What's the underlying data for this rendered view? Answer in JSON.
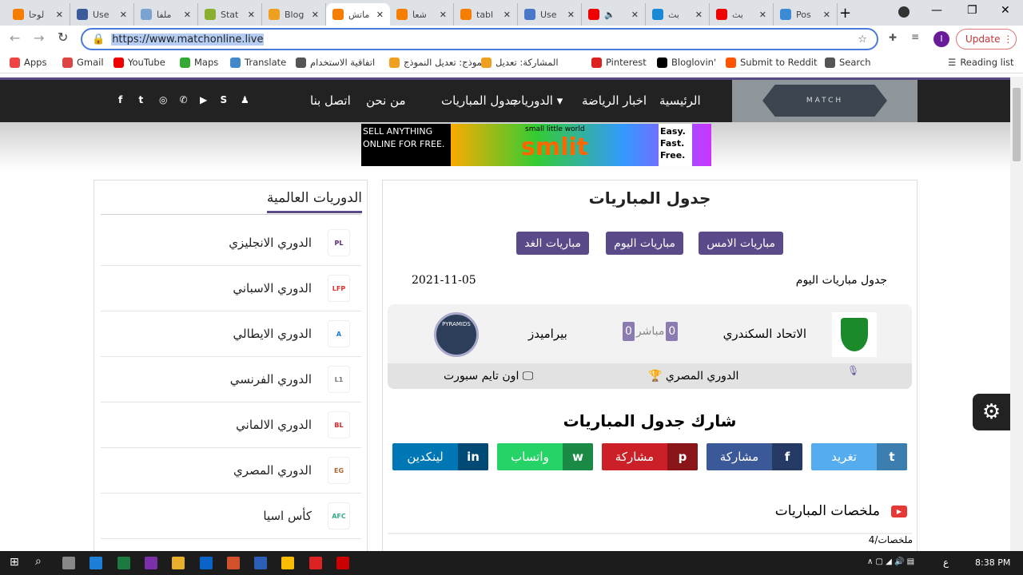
{
  "browser": {
    "tabs": [
      {
        "title": "لوحا",
        "color": "#f57d00"
      },
      {
        "title": "Use",
        "color": "#3a5a9a"
      },
      {
        "title": "ملفا",
        "color": "#7aa3d0"
      },
      {
        "title": "Stat",
        "color": "#8bb030"
      },
      {
        "title": "Blog",
        "color": "#f0a020"
      },
      {
        "title": "ماتش",
        "color": "#f57d00",
        "active": true
      },
      {
        "title": "شعا",
        "color": "#f57d00"
      },
      {
        "title": "tabl",
        "color": "#f57d00"
      },
      {
        "title": "Use",
        "color": "#4a78c8"
      },
      {
        "title": "🔈",
        "color": "#e00"
      },
      {
        "title": "بث",
        "color": "#1a8ad6"
      },
      {
        "title": "بث",
        "color": "#e00"
      },
      {
        "title": "Pos",
        "color": "#3a8ad6"
      }
    ],
    "new_tab": "+",
    "url": "https://www.matchonline.live",
    "profile_initial": "I",
    "update_label": "Update",
    "bookmarks": [
      "Apps",
      "Gmail",
      "YouTube",
      "Maps",
      "Translate",
      "اتفاقية الاستخدام",
      "النموذج: تعديل النموذج",
      "المشاركة: تعديل",
      "Pinterest",
      "Bloglovin'",
      "Submit to Reddit",
      "Search"
    ],
    "reading_list": "Reading list"
  },
  "site": {
    "logo_text": "MATCH",
    "nav": [
      "الرئيسية",
      "اخبار الرياضة",
      "الدوريات ▾",
      "جدول المباريات",
      "من نحن",
      "اتصل بنا"
    ],
    "social_icons": [
      "facebook-icon",
      "twitter-icon",
      "instagram-icon",
      "whatsapp-icon",
      "youtube-icon",
      "skype-icon",
      "snapchat-icon"
    ],
    "ad": {
      "left": "SELL ANYTHING ONLINE FOR FREE.",
      "brand": "smlit",
      "tagline": "small little world",
      "right": "Easy. Fast. Free."
    },
    "sidebar": {
      "title": "الدوريات العالمية",
      "items": [
        {
          "label": "الدوري الانجليزي",
          "badge": "PL"
        },
        {
          "label": "الدوري الاسباني",
          "badge": "LFP"
        },
        {
          "label": "الدوري الايطالي",
          "badge": "A"
        },
        {
          "label": "الدوري الفرنسي",
          "badge": "L1"
        },
        {
          "label": "الدوري الالماني",
          "badge": "BL"
        },
        {
          "label": "الدوري المصري",
          "badge": "EG"
        },
        {
          "label": "كأس اسيا",
          "badge": "AFC"
        }
      ]
    },
    "main": {
      "title": "جدول المباريات",
      "tabs": [
        "مباريات الامس",
        "مباريات اليوم",
        "مباريات الغد"
      ],
      "subtitle": "جدول مباريات اليوم",
      "date": "2021-11-05",
      "match": {
        "home": "الاتحاد السكندري",
        "away": "بيراميدز",
        "home_score": "0",
        "away_score": "0",
        "status": "مباشر",
        "league": "الدوري المصري",
        "channel": "اون تايم سبورت",
        "away_logo_text": "PYRAMIDS"
      },
      "share_title": "شارك جدول المباريات",
      "share": [
        {
          "label": "تغريد",
          "icon": "t",
          "bg": "#55acee",
          "ibg": "#3d7eb0"
        },
        {
          "label": "مشاركة",
          "icon": "f",
          "bg": "#3b5998",
          "ibg": "#263a66"
        },
        {
          "label": "مشاركة",
          "icon": "p",
          "bg": "#cb2027",
          "ibg": "#8a1519"
        },
        {
          "label": "واتساب",
          "icon": "w",
          "bg": "#25d366",
          "ibg": "#1a8a44"
        },
        {
          "label": "لينكدين",
          "icon": "in",
          "bg": "#0077b5",
          "ibg": "#004a75"
        }
      ],
      "highlights_title": "ملخصات المباريات",
      "highlights_path": "4/ملخصات"
    }
  },
  "taskbar": {
    "time": "8:38 PM",
    "lang": "ع"
  }
}
